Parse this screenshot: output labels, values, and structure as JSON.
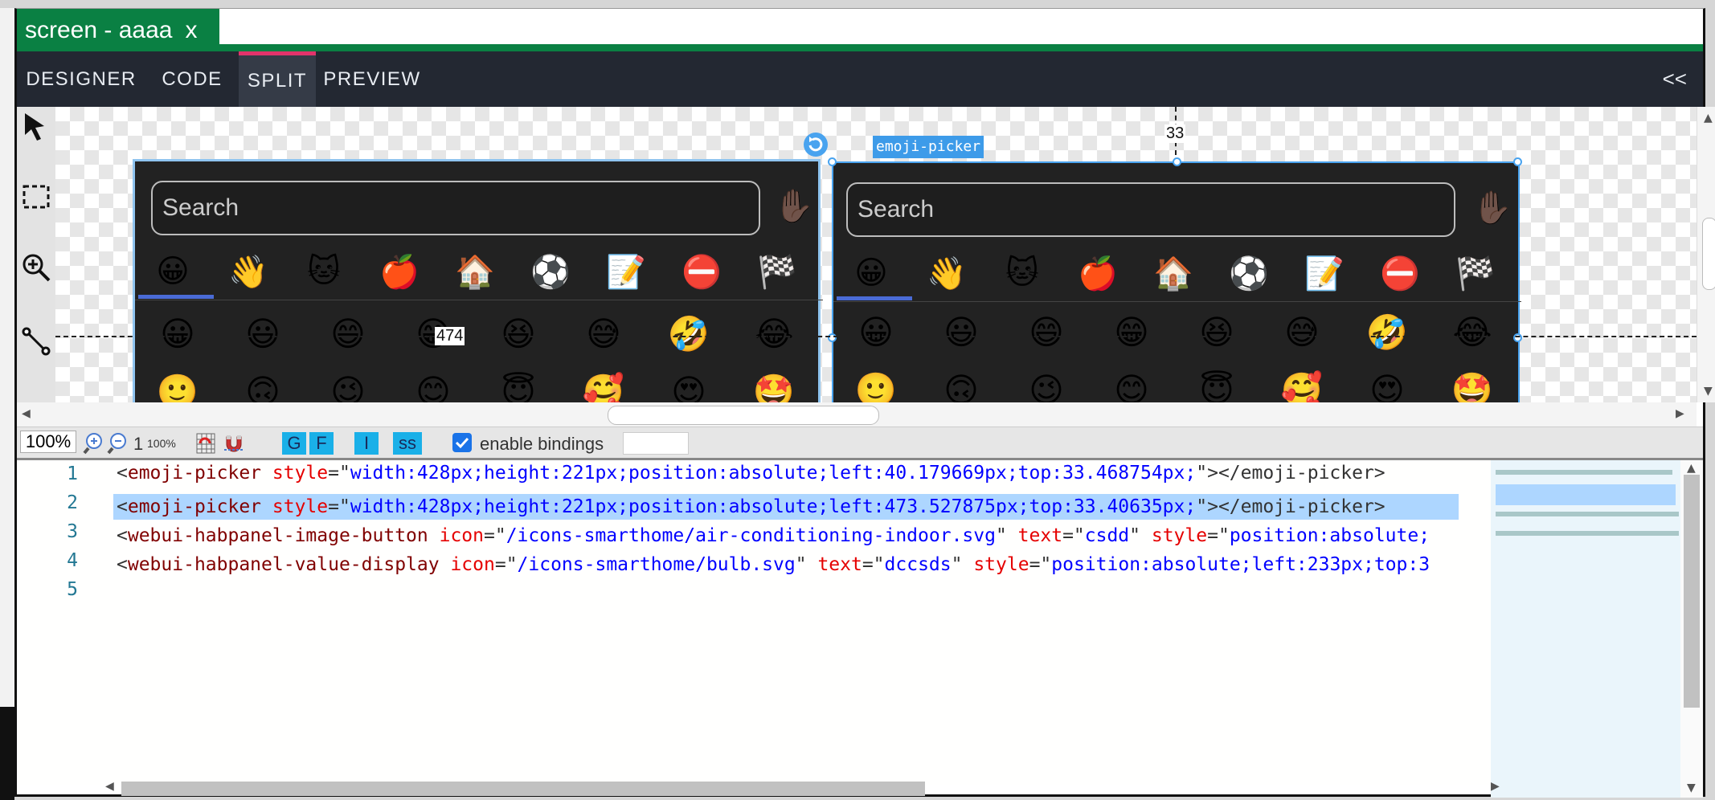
{
  "screen_tab": {
    "label": "screen - aaaa",
    "close": "x"
  },
  "modes": {
    "designer": "DESIGNER",
    "code": "CODE",
    "split": "SPLIT",
    "preview": "PREVIEW",
    "active": "SPLIT"
  },
  "collapse_label": "<<",
  "canvas": {
    "element_tag": "emoji-picker",
    "guide_top": "33",
    "guide_left": "474",
    "search_placeholder": "Search",
    "hand_emoji": "✋🏿",
    "categories": [
      "😀",
      "👋",
      "🐱",
      "🍎",
      "🏠",
      "⚽",
      "📝",
      "⛔",
      "🏁"
    ],
    "emoji_row1": [
      "😀",
      "😃",
      "😄",
      "😁",
      "😆",
      "😅",
      "🤣",
      "😂"
    ],
    "emoji_row2": [
      "🙂",
      "🙃",
      "😉",
      "😊",
      "😇",
      "🥰",
      "😍",
      "🤩"
    ]
  },
  "status_bar": {
    "zoom": "100%",
    "zoom_reset": "1",
    "zoom_100": "100%",
    "btn_g": "G",
    "btn_f": "F",
    "btn_i": "I",
    "btn_ss": "ss",
    "enable_bindings": "enable bindings",
    "enable_bindings_checked": true
  },
  "code_lines": [
    {
      "n": "1",
      "tag": "emoji-picker",
      "attrs": [
        {
          "name": "style",
          "value": "width:428px;height:221px;position:absolute;left:40.179669px;top:33.468754px;"
        }
      ],
      "close": "></emoji-picker>"
    },
    {
      "n": "2",
      "tag": "emoji-picker",
      "attrs": [
        {
          "name": "style",
          "value": "width:428px;height:221px;position:absolute;left:473.527875px;top:33.40635px;"
        }
      ],
      "close": "></emoji-picker>"
    },
    {
      "n": "3",
      "tag": "webui-habpanel-image-button",
      "attrs": [
        {
          "name": "icon",
          "value": "/icons-smarthome/air-conditioning-indoor.svg"
        },
        {
          "name": "text",
          "value": "csdd"
        },
        {
          "name": "style",
          "value": "position:absolute;"
        }
      ],
      "close": ""
    },
    {
      "n": "4",
      "tag": "webui-habpanel-value-display",
      "attrs": [
        {
          "name": "icon",
          "value": "/icons-smarthome/bulb.svg"
        },
        {
          "name": "text",
          "value": "dccsds"
        },
        {
          "name": "style",
          "value": "position:absolute;left:233px;top:3"
        }
      ],
      "close": ""
    },
    {
      "n": "5",
      "tag": "",
      "attrs": [],
      "close": ""
    }
  ],
  "colors": {
    "tab_green": "#0a8043",
    "mode_bar": "#232832",
    "active_accent": "#e2336b",
    "selection": "#49a3ef"
  }
}
